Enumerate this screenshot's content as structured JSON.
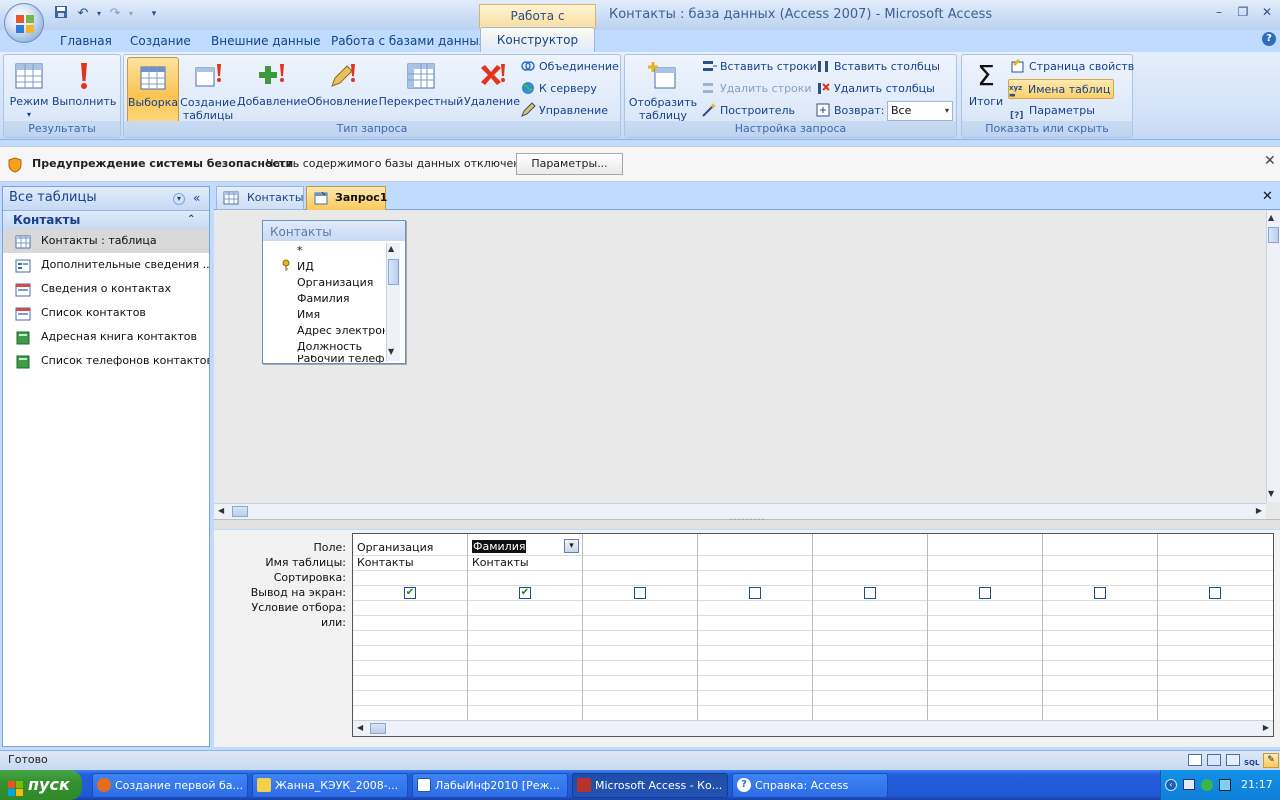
{
  "window": {
    "title": "Контакты : база данных (Access 2007) - Microsoft Access",
    "context_tab": "Работа с запросами",
    "controls": {
      "minimize": "–",
      "restore": "❐",
      "close": "✕"
    }
  },
  "qat": {
    "save_icon": "save-icon",
    "undo_icon": "undo-icon",
    "redo_icon": "redo-icon"
  },
  "tabs": [
    "Главная",
    "Создание",
    "Внешние данные",
    "Работа с базами данных",
    "Конструктор"
  ],
  "ribbon": {
    "results": {
      "label": "Результаты",
      "mode": "Режим",
      "run": "Выполнить"
    },
    "query_type": {
      "label": "Тип запроса",
      "select": "Выборка",
      "make_table": "Создание таблицы",
      "append": "Добавление",
      "update": "Обновление",
      "crosstab": "Перекрестный",
      "delete": "Удаление",
      "union": "Объединение",
      "server": "К серверу",
      "manage": "Управление"
    },
    "setup": {
      "label": "Настройка запроса",
      "show_table": "Отобразить таблицу",
      "insert_rows": "Вставить строки",
      "delete_rows": "Удалить строки",
      "builder": "Построитель",
      "insert_cols": "Вставить столбцы",
      "delete_cols": "Удалить столбцы",
      "return_label": "Возврат:",
      "return_value": "Все"
    },
    "show_hide": {
      "label": "Показать или скрыть",
      "totals": "Итоги",
      "props": "Страница свойств",
      "table_names": "Имена таблиц",
      "params": "Параметры"
    }
  },
  "security": {
    "title": "Предупреждение системы безопасности",
    "text": "Часть содержимого базы данных отключено",
    "button": "Параметры..."
  },
  "nav": {
    "header": "Все таблицы",
    "group": "Контакты",
    "items": [
      "Контакты : таблица",
      "Дополнительные сведения ...",
      "Сведения о контактах",
      "Список контактов",
      "Адресная книга контактов",
      "Список телефонов контактов"
    ]
  },
  "doc_tabs": [
    "Контакты",
    "Запрос1"
  ],
  "table_box": {
    "title": "Контакты",
    "fields": [
      "*",
      "ИД",
      "Организация",
      "Фамилия",
      "Имя",
      "Адрес электронн",
      "Должность",
      "Рабочий телефон"
    ]
  },
  "grid": {
    "row_labels": [
      "Поле:",
      "Имя таблицы:",
      "Сортировка:",
      "Вывод на экран:",
      "Условие отбора:",
      "или:"
    ],
    "columns": [
      {
        "field": "Организация",
        "table": "Контакты",
        "show": true
      },
      {
        "field": "Фамилия",
        "table": "Контакты",
        "show": true
      },
      {
        "field": "",
        "table": "",
        "show": false
      },
      {
        "field": "",
        "table": "",
        "show": false
      },
      {
        "field": "",
        "table": "",
        "show": false
      },
      {
        "field": "",
        "table": "",
        "show": false
      },
      {
        "field": "",
        "table": "",
        "show": false
      },
      {
        "field": "",
        "table": "",
        "show": false
      }
    ]
  },
  "status": {
    "text": "Готово"
  },
  "taskbar": {
    "start": "пуск",
    "buttons": [
      "Создание первой ба...",
      "Жанна_КЭУК_2008-...",
      "ЛабыИнф2010 [Реж...",
      "Microsoft Access - Ко...",
      "Справка: Access"
    ],
    "clock": "21:17"
  }
}
